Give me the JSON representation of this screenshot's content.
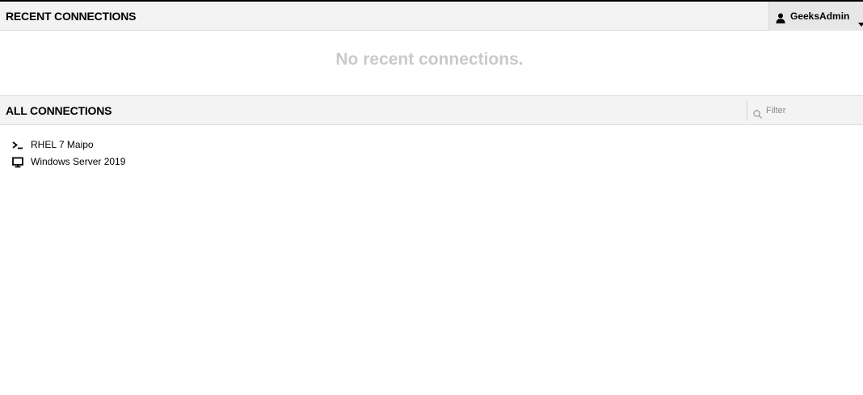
{
  "recent": {
    "title": "RECENT CONNECTIONS",
    "empty_message": "No recent connections."
  },
  "user_menu": {
    "username": "GeeksAdmin",
    "icon": "user-icon"
  },
  "all": {
    "title": "ALL CONNECTIONS",
    "filter_placeholder": "Filter",
    "connections": [
      {
        "label": "RHEL 7 Maipo",
        "icon": "terminal-icon"
      },
      {
        "label": "Windows Server 2019",
        "icon": "monitor-icon"
      }
    ]
  },
  "colors": {
    "header_bg": "#f3f3f3",
    "user_menu_bg": "#e7e7e7",
    "empty_text": "#c9c9c9"
  }
}
